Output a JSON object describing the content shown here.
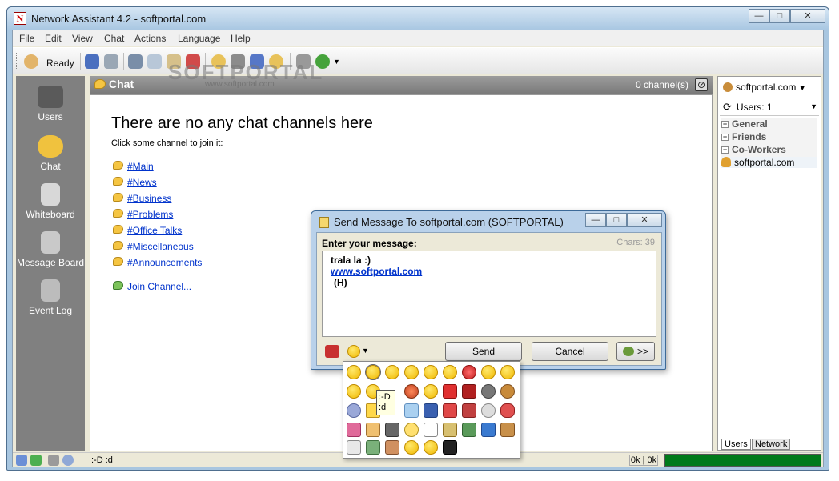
{
  "window": {
    "title": "Network Assistant 4.2 - softportal.com"
  },
  "menu": [
    "File",
    "Edit",
    "View",
    "Chat",
    "Actions",
    "Language",
    "Help"
  ],
  "toolbar": {
    "status_label": "Ready"
  },
  "nav": [
    {
      "label": "Users",
      "icon": "users-icon"
    },
    {
      "label": "Chat",
      "icon": "chat-icon"
    },
    {
      "label": "Whiteboard",
      "icon": "whiteboard-icon"
    },
    {
      "label": "Message Board",
      "icon": "message-board-icon"
    },
    {
      "label": "Event Log",
      "icon": "event-log-icon"
    }
  ],
  "chat": {
    "title": "Chat",
    "channel_count": "0 channel(s)",
    "empty_heading": "There are no any chat channels here",
    "hint": "Click some channel to join it:",
    "channels": [
      "#Main",
      "#News",
      "#Business",
      "#Problems",
      "#Office Talks",
      "#Miscellaneous",
      "#Announcements"
    ],
    "join_link": "Join Channel..."
  },
  "right_panel": {
    "server": "softportal.com",
    "users_label": "Users: 1",
    "groups": [
      "General",
      "Friends",
      "Co-Workers"
    ],
    "user": "softportal.com",
    "tabs": [
      "Users",
      "Network"
    ]
  },
  "status": {
    "text": ":-D :d",
    "traffic": "0k | 0k"
  },
  "dialog": {
    "title": "Send Message To softportal.com (SOFTPORTAL)",
    "prompt": "Enter your message:",
    "chars": "Chars: 39",
    "lines": [
      "trala la :)",
      "www.softportal.com",
      "(H)"
    ],
    "send": "Send",
    "cancel": "Cancel",
    "forward": ">>"
  },
  "tooltip": {
    "line1": ":-D",
    "line2": ":d"
  },
  "watermark": {
    "text": "SOFTPORTAL",
    "sub": "www.softportal.com"
  },
  "colors": {
    "link": "#0033cc",
    "nav_bg": "#808080",
    "net_bar": "#007a1a",
    "bubble": "#f5c542"
  }
}
